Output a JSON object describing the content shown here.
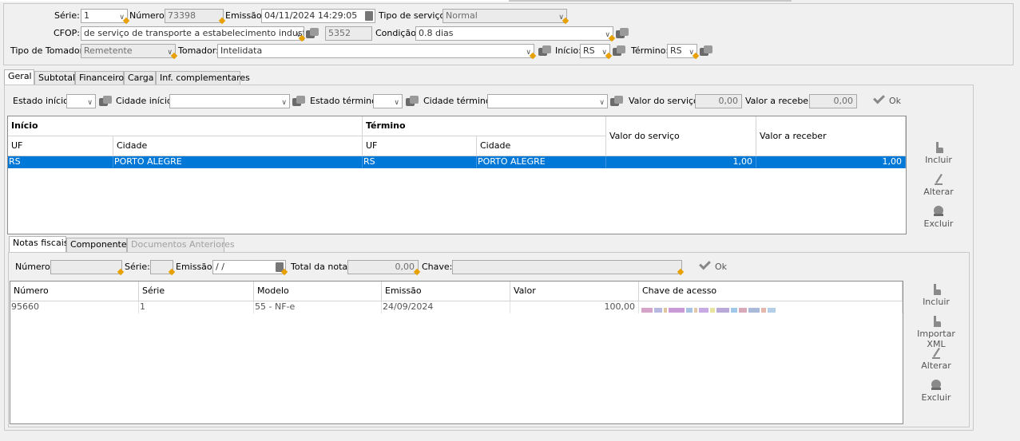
{
  "header": {
    "serie_label": "Série:",
    "serie_value": "1",
    "numero_label": "Número:",
    "numero_value": "73398",
    "emissao_label": "Emissão:",
    "emissao_value": "04/11/2024 14:29:05",
    "tipo_servico_label": "Tipo de serviço:",
    "tipo_servico_value": "Normal",
    "cfop_label": "CFOP:",
    "cfop_value": "de serviço de transporte a estabelecimento industrial",
    "cfop_code": "5352",
    "condicao_label": "Condição:",
    "condicao_value": "0.8 dias",
    "tipo_tomador_label": "Tipo de Tomador:",
    "tipo_tomador_value": "Remetente",
    "tomador_label": "Tomador:",
    "tomador_value": "Intelidata",
    "inicio_label": "Início:",
    "inicio_value": "RS",
    "termino_label": "Término:",
    "termino_value": "RS"
  },
  "tabs": [
    "Geral",
    "Subtotal",
    "Financeiro",
    "Carga",
    "Inf. complementares"
  ],
  "geral": {
    "estado_inicio_label": "Estado início:",
    "cidade_inicio_label": "Cidade início:",
    "estado_termino_label": "Estado término:",
    "cidade_termino_label": "Cidade término:",
    "valor_servico_label": "Valor do serviço:",
    "valor_servico_value": "0,00",
    "valor_receber_label": "Valor a receber:",
    "valor_receber_value": "0,00",
    "ok_label": "Ok",
    "grid": {
      "group_inicio": "Início",
      "group_termino": "Término",
      "col_uf": "UF",
      "col_cidade": "Cidade",
      "col_uf2": "UF",
      "col_cidade2": "Cidade",
      "col_valor_servico": "Valor do serviço",
      "col_valor_receber": "Valor a receber",
      "rows": [
        {
          "uf_inicio": "RS",
          "cidade_inicio": "PORTO ALEGRE",
          "uf_termino": "RS",
          "cidade_termino": "PORTO ALEGRE",
          "valor_servico": "1,00",
          "valor_receber": "1,00"
        }
      ]
    },
    "buttons": {
      "incluir": "Incluir",
      "alterar": "Alterar",
      "excluir": "Excluir"
    }
  },
  "subtabs": [
    "Notas fiscais",
    "Componentes",
    "Documentos Anteriores"
  ],
  "notas": {
    "numero_label": "Número:",
    "serie_label": "Série:",
    "emissao_label": "Emissão:",
    "emissao_value": " / /",
    "total_label": "Total da nota:",
    "total_value": "0,00",
    "chave_label": "Chave:",
    "ok_label": "Ok",
    "grid": {
      "col_numero": "Número",
      "col_serie": "Série",
      "col_modelo": "Modelo",
      "col_emissao": "Emissão",
      "col_valor": "Valor",
      "col_chave": "Chave de acesso",
      "rows": [
        {
          "numero": "95660",
          "serie": "1",
          "modelo": "55 - NF-e",
          "emissao": "24/09/2024",
          "valor": "100,00"
        }
      ]
    },
    "buttons": {
      "incluir": "Incluir",
      "importar_xml": "Importar XML",
      "alterar": "Alterar",
      "excluir": "Excluir"
    }
  },
  "colors": {
    "selection": "#0078d7",
    "marker": "#e8a100"
  }
}
